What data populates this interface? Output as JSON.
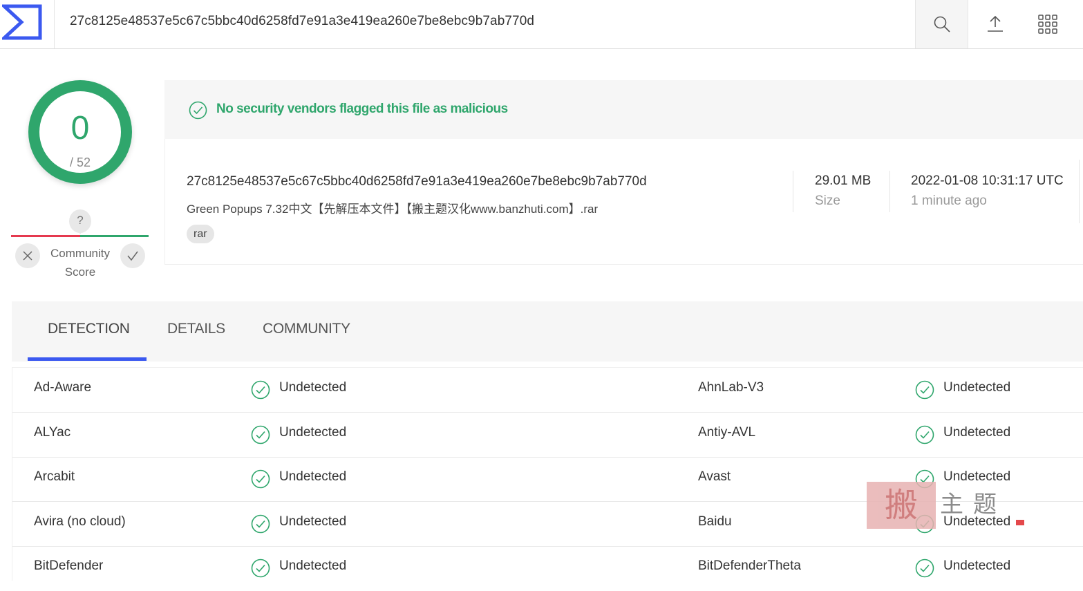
{
  "header": {
    "search_value": "27c8125e48537e5c67c5bbc40d6258fd7e91a3e419ea260e7be8ebc9b7ab770d",
    "icons": [
      "virustotal-logo",
      "search-icon",
      "upload-icon",
      "apps-grid-icon"
    ]
  },
  "score": {
    "detections": "0",
    "total": "/ 52",
    "color": "#2fa66c"
  },
  "community": {
    "question": "?",
    "label_line1": "Community",
    "label_line2": "Score",
    "colors": {
      "negative": "#e5394f",
      "positive": "#2fa66c"
    }
  },
  "verdict": {
    "text": "No security vendors flagged this file as malicious"
  },
  "file": {
    "hash": "27c8125e48537e5c67c5bbc40d6258fd7e91a3e419ea260e7be8ebc9b7ab770d",
    "name": "Green Popups 7.32中文【先解压本文件】【搬主题汉化www.banzhuti.com】.rar",
    "tag": "rar",
    "size_value": "29.01 MB",
    "size_label": "Size",
    "date_value": "2022-01-08 10:31:17 UTC",
    "date_label": "1 minute ago"
  },
  "tabs": [
    {
      "label": "DETECTION",
      "active": true
    },
    {
      "label": "DETAILS",
      "active": false
    },
    {
      "label": "COMMUNITY",
      "active": false
    }
  ],
  "detections": [
    {
      "vendor1": "Ad-Aware",
      "result1": "Undetected",
      "vendor2": "AhnLab-V3",
      "result2": "Undetected"
    },
    {
      "vendor1": "ALYac",
      "result1": "Undetected",
      "vendor2": "Antiy-AVL",
      "result2": "Undetected"
    },
    {
      "vendor1": "Arcabit",
      "result1": "Undetected",
      "vendor2": "Avast",
      "result2": "Undetected"
    },
    {
      "vendor1": "Avira (no cloud)",
      "result1": "Undetected",
      "vendor2": "Baidu",
      "result2": "Undetected"
    },
    {
      "vendor1": "BitDefender",
      "result1": "Undetected",
      "vendor2": "BitDefenderTheta",
      "result2": "Undetected"
    }
  ],
  "watermark": {
    "seal": "搬",
    "text": "主题"
  }
}
